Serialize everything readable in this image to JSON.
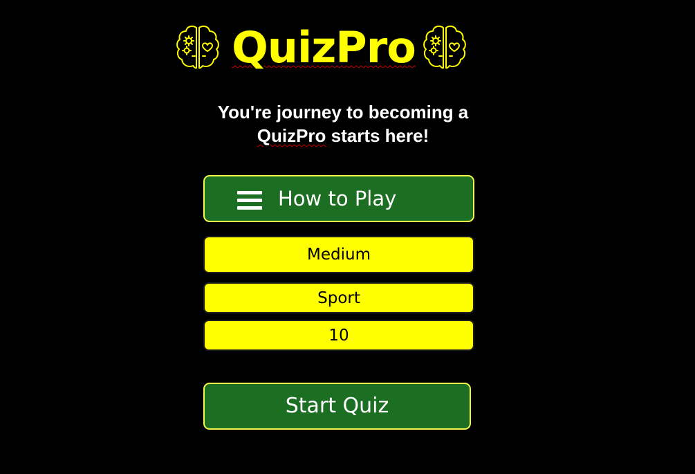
{
  "header": {
    "title": "QuizPro",
    "left_icon": "brain-gears-heart-icon",
    "right_icon": "brain-gears-heart-icon"
  },
  "tagline": {
    "line1": "You're journey to becoming a",
    "brand": "QuizPro",
    "line2_rest": " starts here!"
  },
  "how_to_play": {
    "label": "How to Play",
    "icon": "hamburger-menu-icon"
  },
  "options": {
    "difficulty": "Medium",
    "category": "Sport",
    "question_count": "10"
  },
  "start_button": {
    "label": "Start Quiz"
  },
  "colors": {
    "background": "#000000",
    "accent_yellow": "#FFFF00",
    "button_green": "#1B6E22",
    "button_border": "#F4F84A",
    "text_white": "#FFFFFF"
  }
}
